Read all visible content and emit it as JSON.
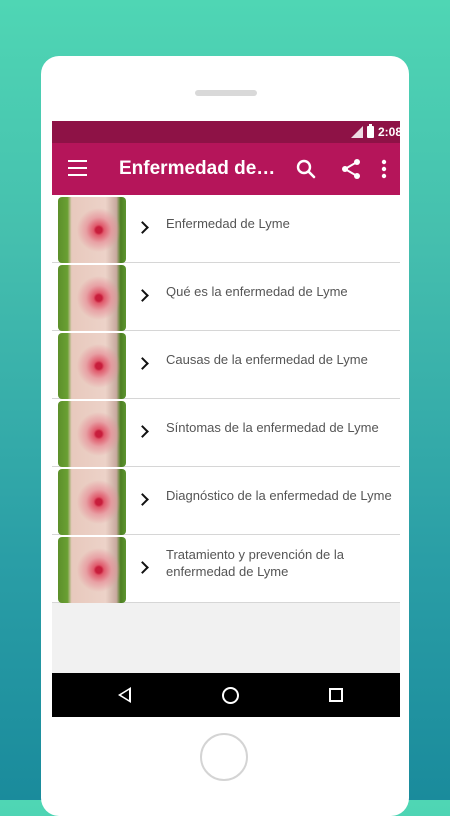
{
  "status_bar": {
    "time": "2:08",
    "icons": [
      "signal-icon",
      "battery-icon"
    ]
  },
  "toolbar": {
    "title": "Enfermedad de Lyme",
    "icons": [
      "menu-icon",
      "search-icon",
      "share-icon",
      "more-vert-icon"
    ]
  },
  "list": {
    "items": [
      {
        "label": "Enfermedad de Lyme"
      },
      {
        "label": "Qué es la enfermedad de Lyme"
      },
      {
        "label": "Causas de la enfermedad de Lyme"
      },
      {
        "label": "Síntomas de la enfermedad de Lyme"
      },
      {
        "label": "Diagnóstico de la enfermedad de Lyme"
      },
      {
        "label": "Tratamiento y prevención de la enfermedad de Lyme"
      }
    ]
  },
  "nav_bar": {
    "icons": [
      "back-icon",
      "home-icon",
      "recents-icon"
    ]
  },
  "colors": {
    "status_bar": "#8e1246",
    "toolbar": "#b5155a",
    "background_top": "#4fd6b4",
    "background_bottom": "#1a8b9c"
  }
}
